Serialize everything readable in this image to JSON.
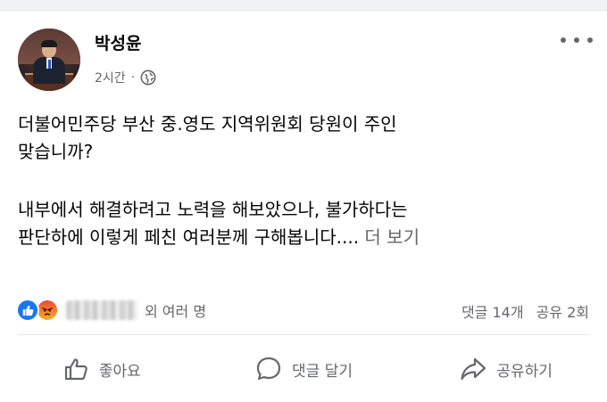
{
  "post": {
    "author": "박성윤",
    "time": "2시간",
    "separator": "·",
    "privacy_icon": "globe-icon",
    "more_icon": "more-options-icon",
    "text_lines": [
      "더불어민주당 부산 중.영도 지역위원회 당원이 주인",
      "맞습니까?",
      "내부에서 해결하려고  노력을 해보았으나, 불가하다는",
      "판단하에 이렇게 페친 여러분께 구해봅니다...."
    ],
    "see_more": "더 보기"
  },
  "reactions": {
    "icons": [
      "like-reaction-icon",
      "angry-reaction-icon"
    ],
    "others_text": "외 여러 명",
    "comments": "댓글 14개",
    "shares": "공유 2회"
  },
  "actions": {
    "like": "좋아요",
    "comment": "댓글 달기",
    "share": "공유하기"
  },
  "colors": {
    "like_blue": "#1877f2",
    "secondary_text": "#65676b",
    "primary_text": "#050505"
  }
}
